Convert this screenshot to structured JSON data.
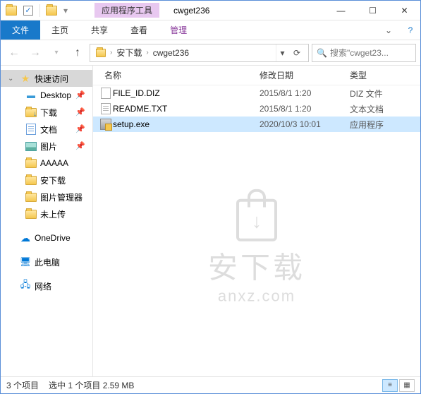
{
  "window": {
    "context_tab": "应用程序工具",
    "title": "cwget236"
  },
  "ribbon": {
    "file": "文件",
    "home": "主页",
    "share": "共享",
    "view": "查看",
    "manage": "管理"
  },
  "address": {
    "seg1": "安下载",
    "seg2": "cwget236"
  },
  "search": {
    "placeholder": "搜索\"cwget23..."
  },
  "sidebar": {
    "quick_access": "快速访问",
    "desktop": "Desktop",
    "downloads": "下载",
    "documents": "文档",
    "pictures": "图片",
    "aaaaa": "AAAAA",
    "anxiazai": "安下载",
    "picmgr": "图片管理器",
    "unuploaded": "未上传",
    "onedrive": "OneDrive",
    "thispc": "此电脑",
    "network": "网络"
  },
  "columns": {
    "name": "名称",
    "date": "修改日期",
    "type": "类型"
  },
  "files": [
    {
      "name": "FILE_ID.DIZ",
      "date": "2015/8/1 1:20",
      "type": "DIZ 文件"
    },
    {
      "name": "README.TXT",
      "date": "2015/8/1 1:20",
      "type": "文本文档"
    },
    {
      "name": "setup.exe",
      "date": "2020/10/3 10:01",
      "type": "应用程序"
    }
  ],
  "watermark": {
    "cn": "安下载",
    "en": "anxz.com"
  },
  "status": {
    "count": "3 个项目",
    "selection": "选中 1 个项目 2.59 MB"
  }
}
